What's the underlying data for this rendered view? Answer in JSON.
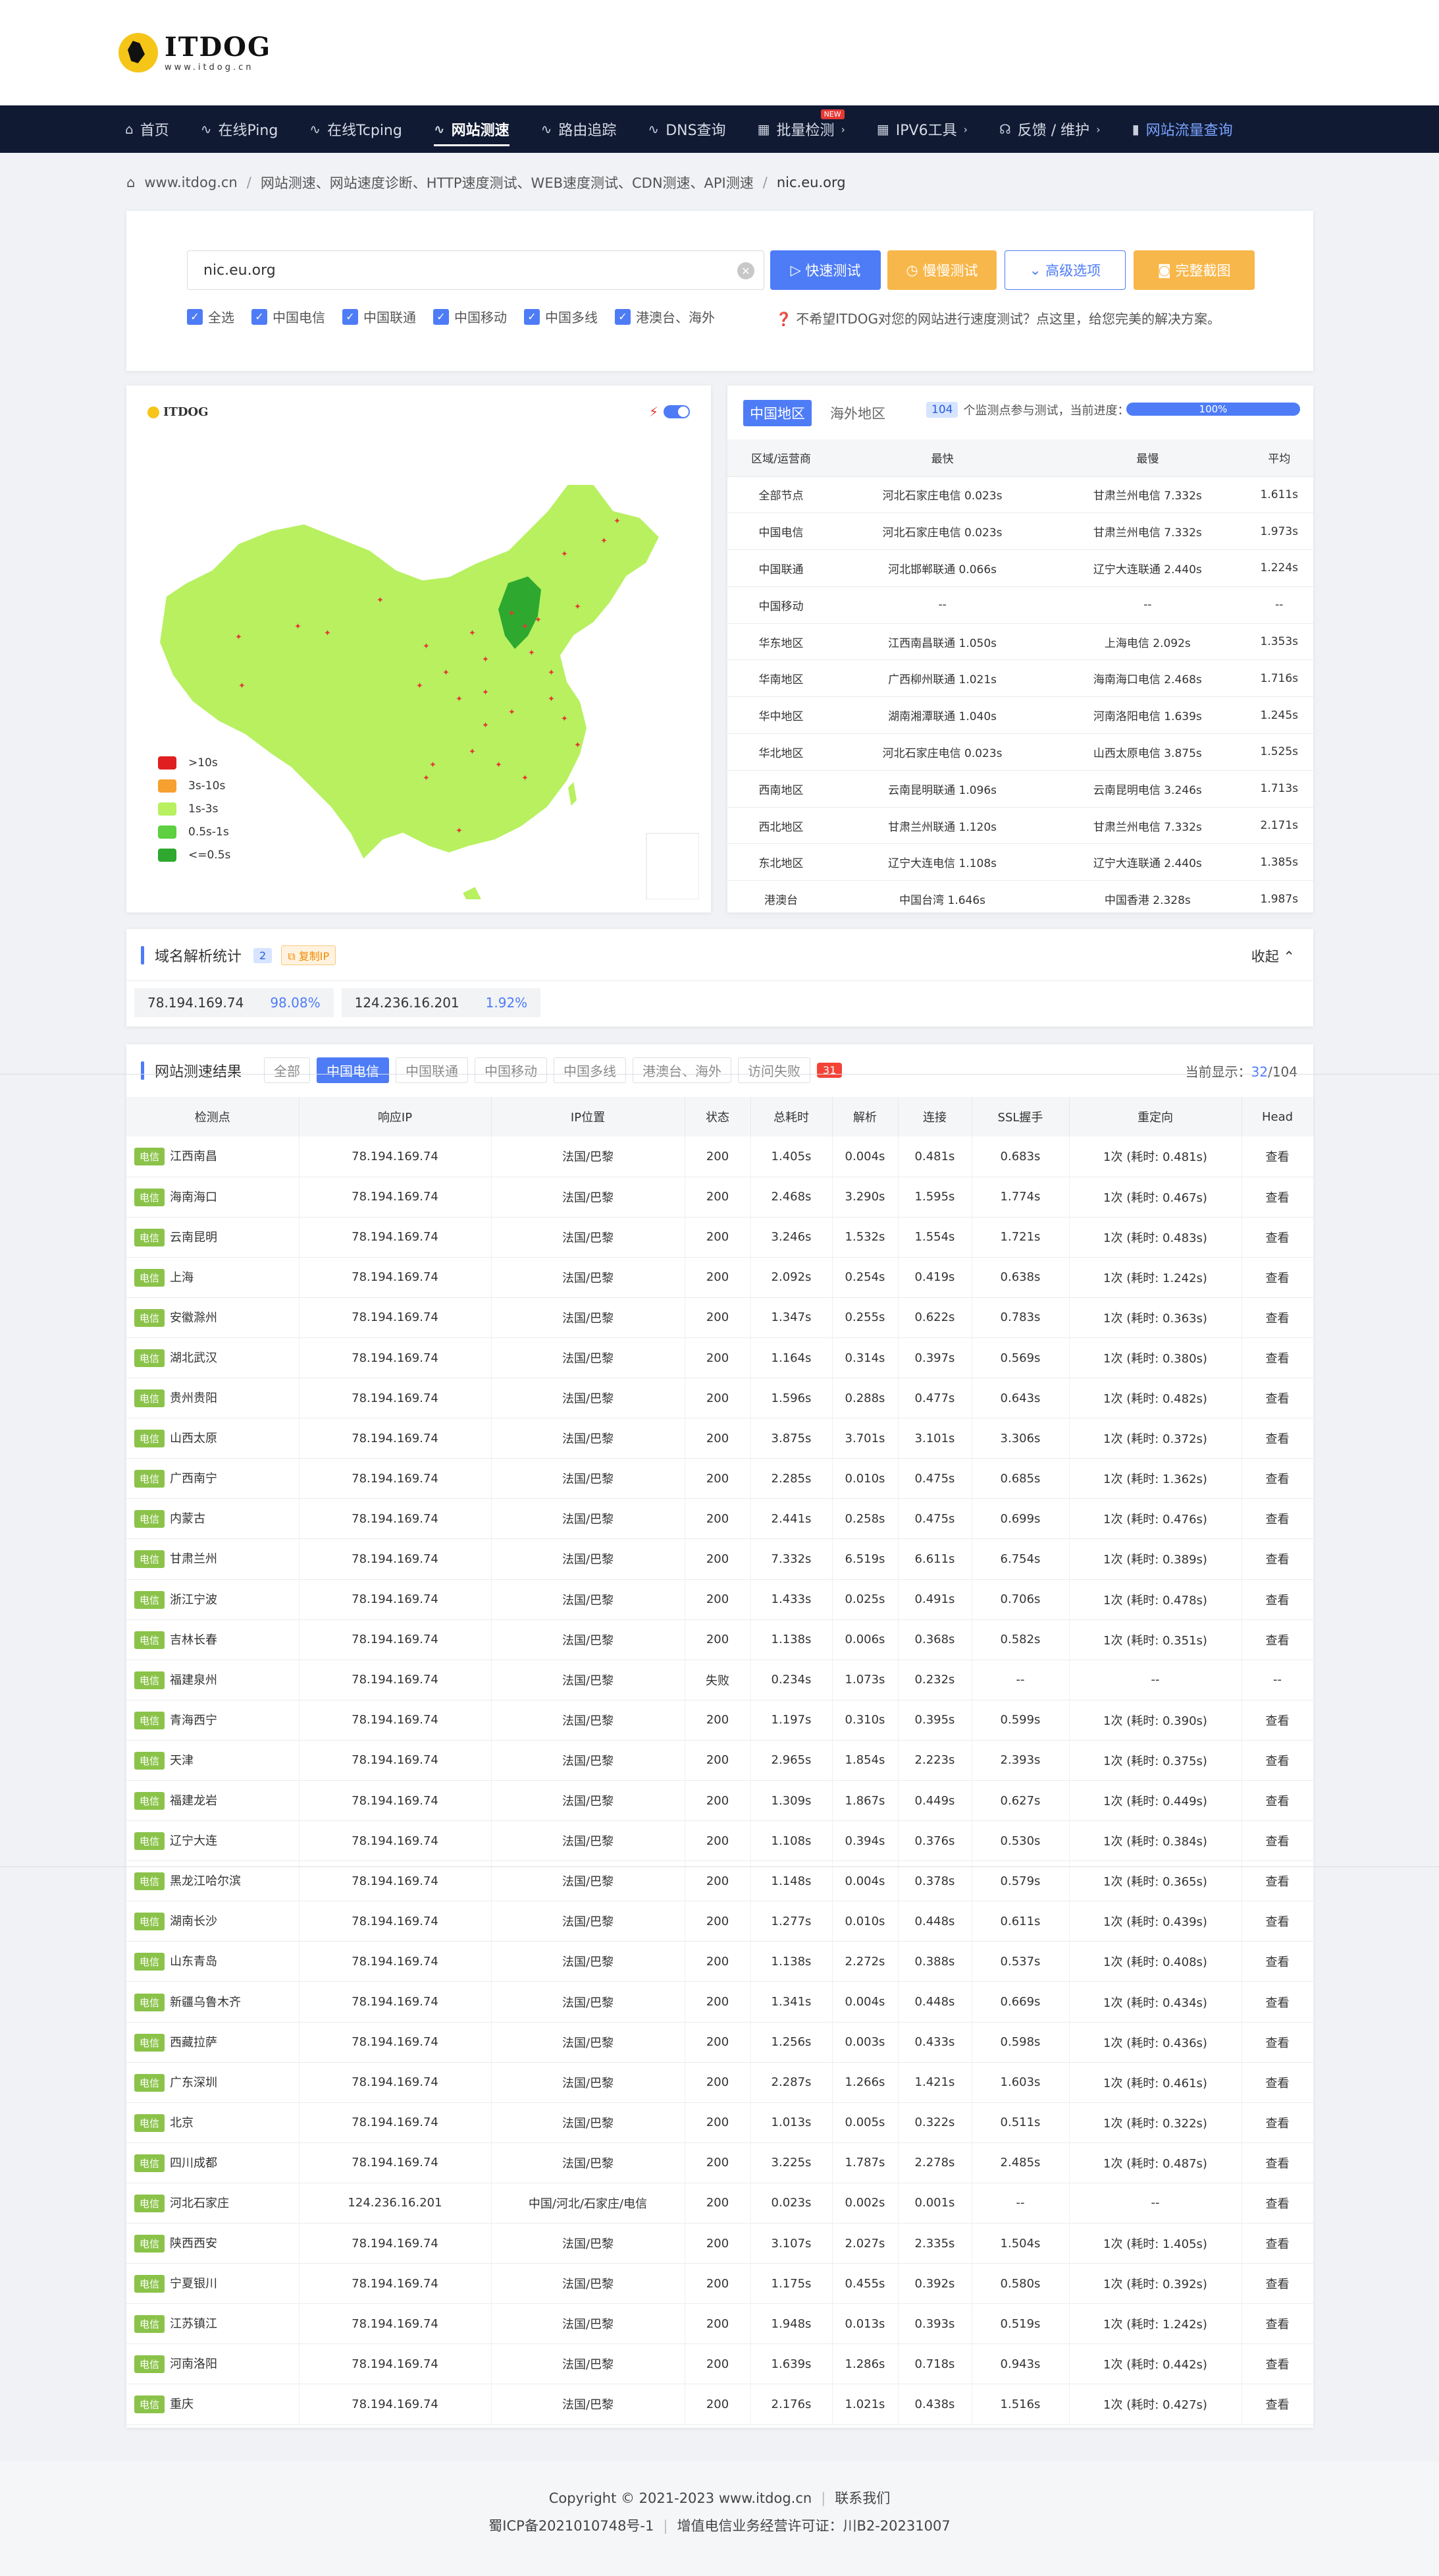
{
  "header": {
    "logo_text": "ITDOG",
    "logo_sub": "www.itdog.cn"
  },
  "nav": [
    {
      "label": "首页",
      "icon": "home-icon",
      "glyph": "⌂"
    },
    {
      "label": "在线Ping",
      "icon": "pulse-icon",
      "glyph": "∿"
    },
    {
      "label": "在线Tcping",
      "icon": "pulse-icon",
      "glyph": "∿"
    },
    {
      "label": "网站测速",
      "icon": "pulse-icon",
      "glyph": "∿",
      "active": true
    },
    {
      "label": "路由追踪",
      "icon": "pulse-icon",
      "glyph": "∿"
    },
    {
      "label": "DNS查询",
      "icon": "pulse-icon",
      "glyph": "∿"
    },
    {
      "label": "批量检测",
      "icon": "grid-icon",
      "glyph": "▦",
      "badge": "NEW",
      "chevron": true
    },
    {
      "label": "IPV6工具",
      "icon": "grid-icon",
      "glyph": "▦",
      "chevron": true
    },
    {
      "label": "反馈 / 维护",
      "icon": "headset-icon",
      "glyph": "☊",
      "chevron": true
    },
    {
      "label": "网站流量查询",
      "icon": "bar-chart-icon",
      "glyph": "▮",
      "highlight": true
    }
  ],
  "breadcrumb": [
    "www.itdog.cn",
    "网站测速、网站速度诊断、HTTP速度测试、WEB速度测试、CDN测速、API测速",
    "nic.eu.org"
  ],
  "search": {
    "value": "nic.eu.org",
    "quick": "快速测试",
    "slow": "慢慢测试",
    "advanced": "高级选项",
    "screenshot": "完整截图",
    "checks": [
      "全选",
      "中国电信",
      "中国联通",
      "中国移动",
      "中国多线",
      "港澳台、海外"
    ],
    "notice": "不希望ITDOG对您的网站进行速度测试？点这里，给您完美的解决方案。"
  },
  "map": {
    "logo": "ITDOG",
    "legend": [
      {
        "label": ">10s",
        "color": "#e02020"
      },
      {
        "label": "3s-10s",
        "color": "#f5a030"
      },
      {
        "label": "1s-3s",
        "color": "#b8f060"
      },
      {
        "label": "0.5s-1s",
        "color": "#5cd040"
      },
      {
        "label": "<=0.5s",
        "color": "#2ea82e"
      }
    ],
    "land_color": "#b8f060",
    "fast_color": "#2ea82e"
  },
  "stats": {
    "tab_cn": "中国地区",
    "tab_overseas": "海外地区",
    "node_count": "104",
    "progress_text": "个监测点参与测试，当前进度：",
    "progress": "100%",
    "progress_value": 100,
    "headers": [
      "区域/运营商",
      "最快",
      "最慢",
      "平均"
    ],
    "rows": [
      [
        "全部节点",
        "河北石家庄电信 0.023s",
        "甘肃兰州电信 7.332s",
        "1.611s"
      ],
      [
        "中国电信",
        "河北石家庄电信 0.023s",
        "甘肃兰州电信 7.332s",
        "1.973s"
      ],
      [
        "中国联通",
        "河北邯郸联通 0.066s",
        "辽宁大连联通 2.440s",
        "1.224s"
      ],
      [
        "中国移动",
        "--",
        "--",
        "--"
      ],
      [
        "华东地区",
        "江西南昌联通 1.050s",
        "上海电信 2.092s",
        "1.353s"
      ],
      [
        "华南地区",
        "广西柳州联通 1.021s",
        "海南海口电信 2.468s",
        "1.716s"
      ],
      [
        "华中地区",
        "湖南湘潭联通 1.040s",
        "河南洛阳电信 1.639s",
        "1.245s"
      ],
      [
        "华北地区",
        "河北石家庄电信 0.023s",
        "山西太原电信 3.875s",
        "1.525s"
      ],
      [
        "西南地区",
        "云南昆明联通 1.096s",
        "云南昆明电信 3.246s",
        "1.713s"
      ],
      [
        "西北地区",
        "甘肃兰州联通 1.120s",
        "甘肃兰州电信 7.332s",
        "2.171s"
      ],
      [
        "东北地区",
        "辽宁大连电信 1.108s",
        "辽宁大连联通 2.440s",
        "1.385s"
      ],
      [
        "港澳台",
        "中国台湾 1.646s",
        "中国香港 2.328s",
        "1.987s"
      ]
    ]
  },
  "dns": {
    "title": "域名解析统计",
    "count": "2",
    "copy": "复制IP",
    "collapse": "收起",
    "ips": [
      {
        "ip": "78.194.169.74",
        "pct": "98.08%"
      },
      {
        "ip": "124.236.16.201",
        "pct": "1.92%"
      }
    ]
  },
  "results": {
    "title": "网站测速结果",
    "filters": [
      "全部",
      "中国电信",
      "中国联通",
      "中国移动",
      "中国多线",
      "港澳台、海外",
      "访问失败"
    ],
    "fail_count": "31",
    "current_label": "当前显示：",
    "current": "32",
    "total": "/104",
    "headers": [
      "检测点",
      "响应IP",
      "IP位置",
      "状态",
      "总耗时",
      "解析",
      "连接",
      "SSL握手",
      "重定向",
      "Head"
    ],
    "isp_label": "电信",
    "rows": [
      [
        "江西南昌",
        "78.194.169.74",
        "法国/巴黎",
        "200",
        "1.405s",
        "0.004s",
        "0.481s",
        "0.683s",
        "1次 (耗时: 0.481s)",
        "查看"
      ],
      [
        "海南海口",
        "78.194.169.74",
        "法国/巴黎",
        "200",
        "2.468s",
        "3.290s",
        "1.595s",
        "1.774s",
        "1次 (耗时: 0.467s)",
        "查看"
      ],
      [
        "云南昆明",
        "78.194.169.74",
        "法国/巴黎",
        "200",
        "3.246s",
        "1.532s",
        "1.554s",
        "1.721s",
        "1次 (耗时: 0.483s)",
        "查看"
      ],
      [
        "上海",
        "78.194.169.74",
        "法国/巴黎",
        "200",
        "2.092s",
        "0.254s",
        "0.419s",
        "0.638s",
        "1次 (耗时: 1.242s)",
        "查看"
      ],
      [
        "安徽滁州",
        "78.194.169.74",
        "法国/巴黎",
        "200",
        "1.347s",
        "0.255s",
        "0.622s",
        "0.783s",
        "1次 (耗时: 0.363s)",
        "查看"
      ],
      [
        "湖北武汉",
        "78.194.169.74",
        "法国/巴黎",
        "200",
        "1.164s",
        "0.314s",
        "0.397s",
        "0.569s",
        "1次 (耗时: 0.380s)",
        "查看"
      ],
      [
        "贵州贵阳",
        "78.194.169.74",
        "法国/巴黎",
        "200",
        "1.596s",
        "0.288s",
        "0.477s",
        "0.643s",
        "1次 (耗时: 0.482s)",
        "查看"
      ],
      [
        "山西太原",
        "78.194.169.74",
        "法国/巴黎",
        "200",
        "3.875s",
        "3.701s",
        "3.101s",
        "3.306s",
        "1次 (耗时: 0.372s)",
        "查看"
      ],
      [
        "广西南宁",
        "78.194.169.74",
        "法国/巴黎",
        "200",
        "2.285s",
        "0.010s",
        "0.475s",
        "0.685s",
        "1次 (耗时: 1.362s)",
        "查看"
      ],
      [
        "内蒙古",
        "78.194.169.74",
        "法国/巴黎",
        "200",
        "2.441s",
        "0.258s",
        "0.475s",
        "0.699s",
        "1次 (耗时: 0.476s)",
        "查看"
      ],
      [
        "甘肃兰州",
        "78.194.169.74",
        "法国/巴黎",
        "200",
        "7.332s",
        "6.519s",
        "6.611s",
        "6.754s",
        "1次 (耗时: 0.389s)",
        "查看"
      ],
      [
        "浙江宁波",
        "78.194.169.74",
        "法国/巴黎",
        "200",
        "1.433s",
        "0.025s",
        "0.491s",
        "0.706s",
        "1次 (耗时: 0.478s)",
        "查看"
      ],
      [
        "吉林长春",
        "78.194.169.74",
        "法国/巴黎",
        "200",
        "1.138s",
        "0.006s",
        "0.368s",
        "0.582s",
        "1次 (耗时: 0.351s)",
        "查看"
      ],
      [
        "福建泉州",
        "78.194.169.74",
        "法国/巴黎",
        "失败",
        "0.234s",
        "1.073s",
        "0.232s",
        "--",
        "--",
        "--"
      ],
      [
        "青海西宁",
        "78.194.169.74",
        "法国/巴黎",
        "200",
        "1.197s",
        "0.310s",
        "0.395s",
        "0.599s",
        "1次 (耗时: 0.390s)",
        "查看"
      ],
      [
        "天津",
        "78.194.169.74",
        "法国/巴黎",
        "200",
        "2.965s",
        "1.854s",
        "2.223s",
        "2.393s",
        "1次 (耗时: 0.375s)",
        "查看"
      ],
      [
        "福建龙岩",
        "78.194.169.74",
        "法国/巴黎",
        "200",
        "1.309s",
        "1.867s",
        "0.449s",
        "0.627s",
        "1次 (耗时: 0.449s)",
        "查看"
      ],
      [
        "辽宁大连",
        "78.194.169.74",
        "法国/巴黎",
        "200",
        "1.108s",
        "0.394s",
        "0.376s",
        "0.530s",
        "1次 (耗时: 0.384s)",
        "查看"
      ],
      [
        "黑龙江哈尔滨",
        "78.194.169.74",
        "法国/巴黎",
        "200",
        "1.148s",
        "0.004s",
        "0.378s",
        "0.579s",
        "1次 (耗时: 0.365s)",
        "查看"
      ],
      [
        "湖南长沙",
        "78.194.169.74",
        "法国/巴黎",
        "200",
        "1.277s",
        "0.010s",
        "0.448s",
        "0.611s",
        "1次 (耗时: 0.439s)",
        "查看"
      ],
      [
        "山东青岛",
        "78.194.169.74",
        "法国/巴黎",
        "200",
        "1.138s",
        "2.272s",
        "0.388s",
        "0.537s",
        "1次 (耗时: 0.408s)",
        "查看"
      ],
      [
        "新疆乌鲁木齐",
        "78.194.169.74",
        "法国/巴黎",
        "200",
        "1.341s",
        "0.004s",
        "0.448s",
        "0.669s",
        "1次 (耗时: 0.434s)",
        "查看"
      ],
      [
        "西藏拉萨",
        "78.194.169.74",
        "法国/巴黎",
        "200",
        "1.256s",
        "0.003s",
        "0.433s",
        "0.598s",
        "1次 (耗时: 0.436s)",
        "查看"
      ],
      [
        "广东深圳",
        "78.194.169.74",
        "法国/巴黎",
        "200",
        "2.287s",
        "1.266s",
        "1.421s",
        "1.603s",
        "1次 (耗时: 0.461s)",
        "查看"
      ],
      [
        "北京",
        "78.194.169.74",
        "法国/巴黎",
        "200",
        "1.013s",
        "0.005s",
        "0.322s",
        "0.511s",
        "1次 (耗时: 0.322s)",
        "查看"
      ],
      [
        "四川成都",
        "78.194.169.74",
        "法国/巴黎",
        "200",
        "3.225s",
        "1.787s",
        "2.278s",
        "2.485s",
        "1次 (耗时: 0.487s)",
        "查看"
      ],
      [
        "河北石家庄",
        "124.236.16.201",
        "中国/河北/石家庄/电信",
        "200",
        "0.023s",
        "0.002s",
        "0.001s",
        "--",
        "--",
        "查看"
      ],
      [
        "陕西西安",
        "78.194.169.74",
        "法国/巴黎",
        "200",
        "3.107s",
        "2.027s",
        "2.335s",
        "1.504s",
        "1次 (耗时: 1.405s)",
        "查看"
      ],
      [
        "宁夏银川",
        "78.194.169.74",
        "法国/巴黎",
        "200",
        "1.175s",
        "0.455s",
        "0.392s",
        "0.580s",
        "1次 (耗时: 0.392s)",
        "查看"
      ],
      [
        "江苏镇江",
        "78.194.169.74",
        "法国/巴黎",
        "200",
        "1.948s",
        "0.013s",
        "0.393s",
        "0.519s",
        "1次 (耗时: 1.242s)",
        "查看"
      ],
      [
        "河南洛阳",
        "78.194.169.74",
        "法国/巴黎",
        "200",
        "1.639s",
        "1.286s",
        "0.718s",
        "0.943s",
        "1次 (耗时: 0.442s)",
        "查看"
      ],
      [
        "重庆",
        "78.194.169.74",
        "法国/巴黎",
        "200",
        "2.176s",
        "1.021s",
        "0.438s",
        "1.516s",
        "1次 (耗时: 0.427s)",
        "查看"
      ]
    ]
  },
  "footer": {
    "copyright": "Copyright © 2021-2023 www.itdog.cn",
    "contact": "联系我们",
    "icp": "蜀ICP备2021010748号-1",
    "license": "增值电信业务经营许可证：川B2-20231007"
  }
}
